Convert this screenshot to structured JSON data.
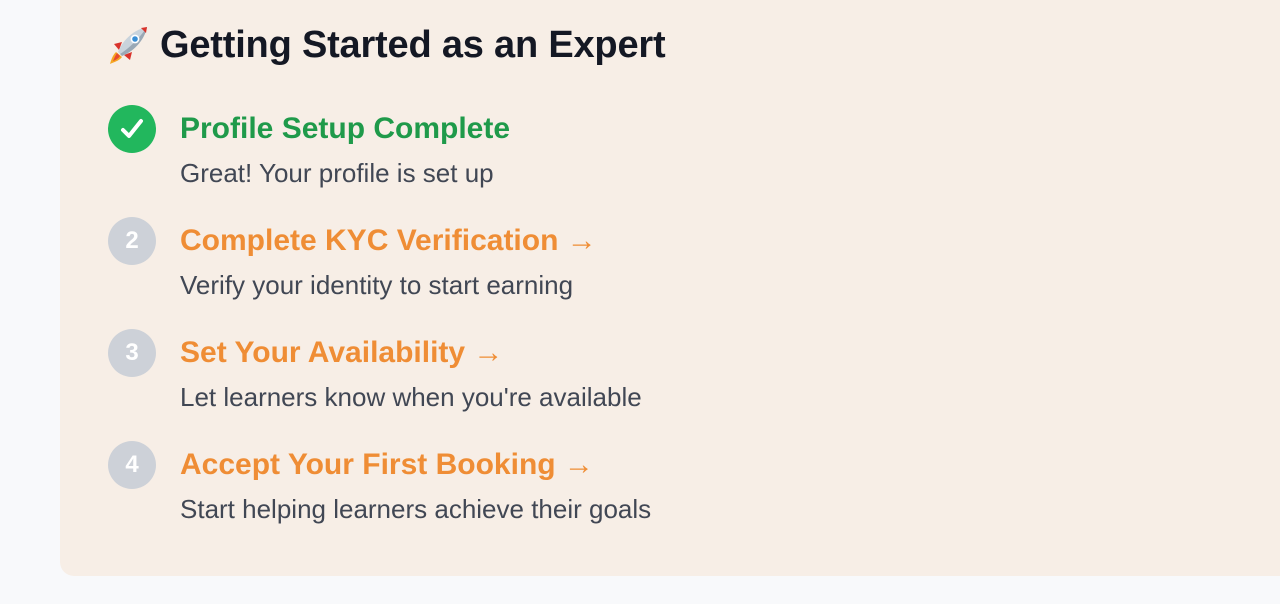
{
  "heading": {
    "icon": "rocket-icon",
    "title": "Getting Started as an Expert"
  },
  "steps": [
    {
      "badge": "✓",
      "badge_icon": "checkmark-icon",
      "status": "complete",
      "title": "Profile Setup Complete",
      "description": "Great! Your profile is set up"
    },
    {
      "badge": "2",
      "status": "pending",
      "title": "Complete KYC Verification →",
      "description": "Verify your identity to start earning"
    },
    {
      "badge": "3",
      "status": "pending",
      "title": "Set Your Availability →",
      "description": "Let learners know when you're available"
    },
    {
      "badge": "4",
      "status": "pending",
      "title": "Accept Your First Booking →",
      "description": "Start helping learners achieve their goals"
    }
  ],
  "colors": {
    "card_background": "#f7eee6",
    "complete": "#1f9a4a",
    "complete_badge": "#22b75d",
    "pending": "#ef8d35",
    "pending_badge": "#cdd1d8",
    "heading_text": "#141824",
    "description_text": "#414754"
  }
}
